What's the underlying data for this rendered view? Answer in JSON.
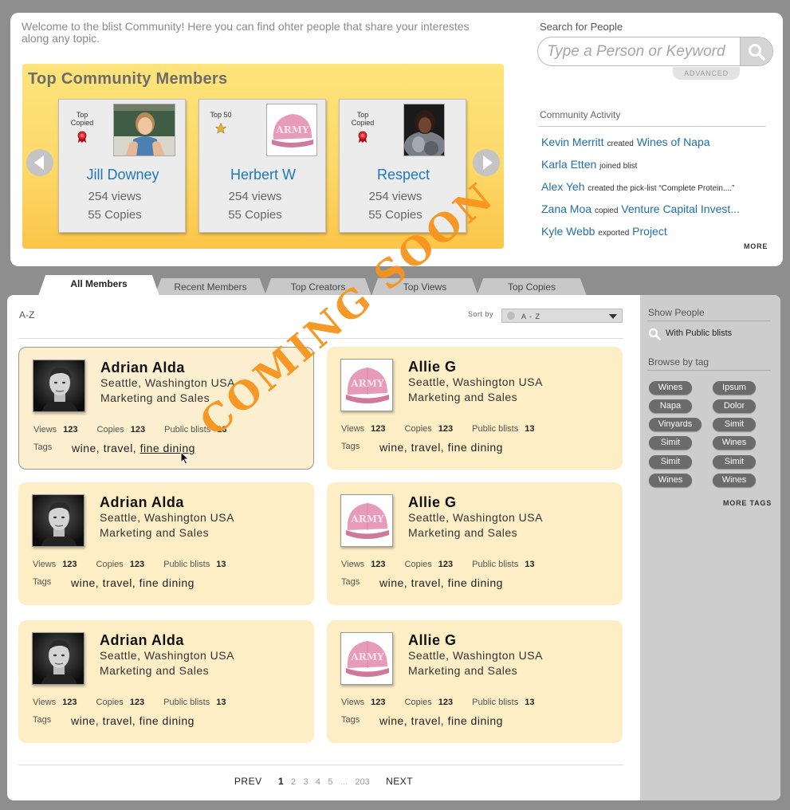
{
  "welcome": "Welcome to the blist Community!  Here you can find ohter people that share your interestes along any topic.",
  "featured": {
    "title": "Top Community Members",
    "members": [
      {
        "badge": "Top Copied",
        "medal": "red-ribbon",
        "name": "Jill Downey",
        "views": "254 views",
        "copies": "55 Copies"
      },
      {
        "badge": "Top 50",
        "medal": "gold-star",
        "name": "Herbert W",
        "views": "254 views",
        "copies": "55 Copies"
      },
      {
        "badge": "Top Copied",
        "medal": "red-ribbon",
        "name": "Respect",
        "views": "254 views",
        "copies": "55 Copies"
      }
    ]
  },
  "search": {
    "label": "Search for People",
    "placeholder": "Type a Person or Keyword",
    "advanced": "ADVANCED"
  },
  "activity": {
    "title": "Community Activity",
    "items": [
      {
        "user": "Kevin Merritt",
        "verb": "created",
        "target": "Wines of Napa"
      },
      {
        "user": "Karla Etten",
        "verb": "joined blist",
        "target": ""
      },
      {
        "user": "Alex Yeh",
        "verb": "created the pick-list “Complete Protein....”",
        "target": ""
      },
      {
        "user": "Zana Moa",
        "verb": "copied",
        "target": "Venture Capital Invest..."
      },
      {
        "user": "Kyle Webb",
        "verb": "exported",
        "target": "Project"
      }
    ],
    "more": "MORE"
  },
  "tabs": [
    "All Members",
    "Recent Members",
    "Top Creators",
    "Top Views",
    "Top Copies"
  ],
  "listing": {
    "az": "A-Z",
    "sort_label": "Sort by",
    "sort_value": "A - Z"
  },
  "members": [
    {
      "name": "Adrian Alda",
      "location": "Seattle, Washington USA",
      "dept": "Marketing and Sales",
      "views_label": "Views",
      "views": "123",
      "copies_label": "Copies",
      "copies": "123",
      "public_label": "Public blists",
      "public": "13",
      "tags_label": "Tags",
      "tags": "wine, travel, ",
      "tag_link": "fine dining",
      "photo": "man"
    },
    {
      "name": "Allie G",
      "location": "Seattle, Washington USA",
      "dept": "Marketing and Sales",
      "views_label": "Views",
      "views": "123",
      "copies_label": "Copies",
      "copies": "123",
      "public_label": "Public blists",
      "public": "13",
      "tags_label": "Tags",
      "tags": "wine, travel, ",
      "tag_link": "fine dining",
      "photo": "cap"
    },
    {
      "name": "Adrian Alda",
      "location": "Seattle, Washington USA",
      "dept": "Marketing and Sales",
      "views_label": "Views",
      "views": "123",
      "copies_label": "Copies",
      "copies": "123",
      "public_label": "Public blists",
      "public": "13",
      "tags_label": "Tags",
      "tags": "wine, travel, ",
      "tag_link": "fine dining",
      "photo": "man"
    },
    {
      "name": "Allie G",
      "location": "Seattle, Washington USA",
      "dept": "Marketing and Sales",
      "views_label": "Views",
      "views": "123",
      "copies_label": "Copies",
      "copies": "123",
      "public_label": "Public blists",
      "public": "13",
      "tags_label": "Tags",
      "tags": "wine, travel, ",
      "tag_link": "fine dining",
      "photo": "cap"
    },
    {
      "name": "Adrian Alda",
      "location": "Seattle, Washington USA",
      "dept": "Marketing and Sales",
      "views_label": "Views",
      "views": "123",
      "copies_label": "Copies",
      "copies": "123",
      "public_label": "Public blists",
      "public": "13",
      "tags_label": "Tags",
      "tags": "wine, travel, ",
      "tag_link": "fine dining",
      "photo": "man"
    },
    {
      "name": "Allie G",
      "location": "Seattle, Washington USA",
      "dept": "Marketing and Sales",
      "views_label": "Views",
      "views": "123",
      "copies_label": "Copies",
      "copies": "123",
      "public_label": "Public blists",
      "public": "13",
      "tags_label": "Tags",
      "tags": "wine, travel, ",
      "tag_link": "fine dining",
      "photo": "cap"
    }
  ],
  "pager": {
    "prev": "PREV",
    "pages": [
      "1",
      "2",
      "3",
      "4",
      "5"
    ],
    "ellipsis": "...",
    "last": "203",
    "next": "NEXT"
  },
  "sidebar": {
    "show_title": "Show People",
    "public_filter": "With Public blists",
    "browse_title": "Browse by tag",
    "tags": [
      "Wines",
      "Ipsum",
      "Napa",
      "Dolor",
      "Vinyards",
      "Simit",
      "Simit",
      "Wines",
      "Simit",
      "Simit",
      "Wines",
      "Wines"
    ],
    "more_tags": "MORE TAGS"
  },
  "stamp": "COMING SOON",
  "colors": {
    "link": "#1f78b4",
    "card": "#fdeec6",
    "featured": "#fcd969",
    "stamp": "#f7941d",
    "tag": "#6b6b6b"
  }
}
